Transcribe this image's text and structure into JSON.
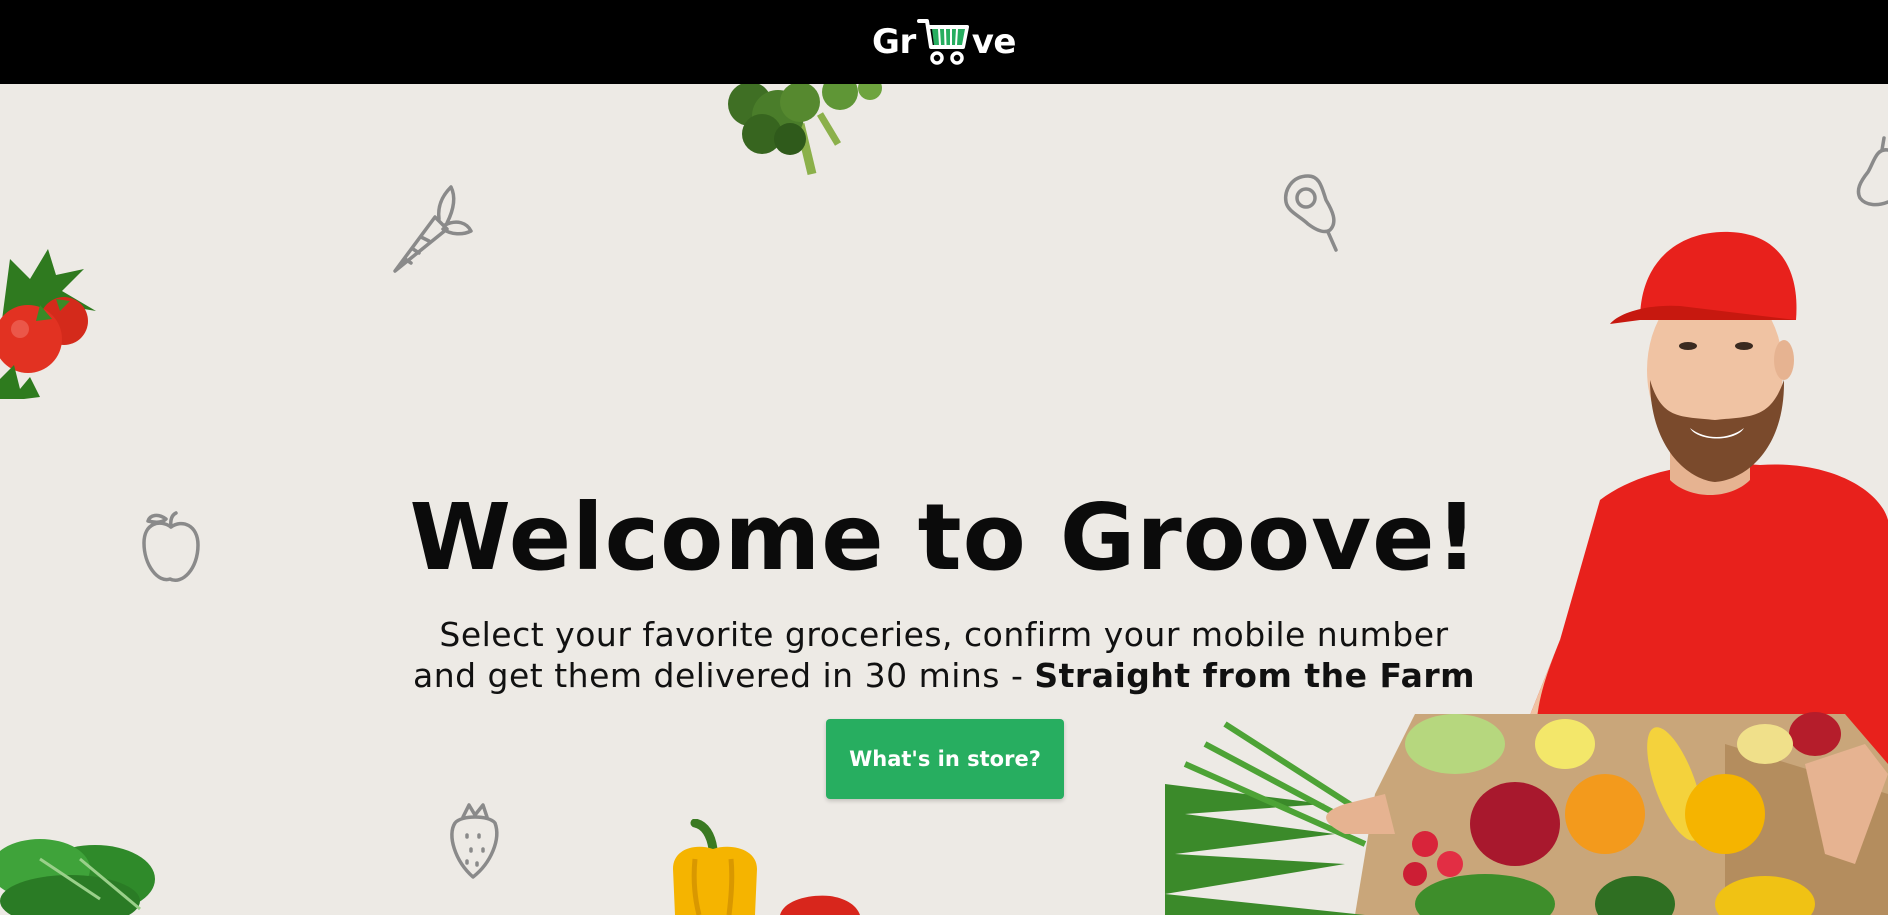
{
  "header": {
    "logo": {
      "text_left": "Gr",
      "text_right": "ve",
      "icon": "shopping-cart-icon",
      "accent": "#27ae60"
    }
  },
  "hero": {
    "title": "Welcome to Groove!",
    "subtitle_line1": "Select your favorite groceries, confirm your mobile number",
    "subtitle_line2": "and get them delivered in 30 mins - ",
    "subtitle_bold": "Straight from the Farm",
    "cta_label": "What's in store?",
    "cta_color": "#27ae60",
    "background": "#edeae5"
  },
  "decorations": [
    "broccoli-image",
    "carrot-icon",
    "avocado-icon",
    "pear-icon",
    "tomato-image",
    "apple-icon",
    "strawberry-icon",
    "spinach-image",
    "yellow-pepper-image",
    "red-pepper-image",
    "delivery-man-image",
    "produce-box-image"
  ]
}
